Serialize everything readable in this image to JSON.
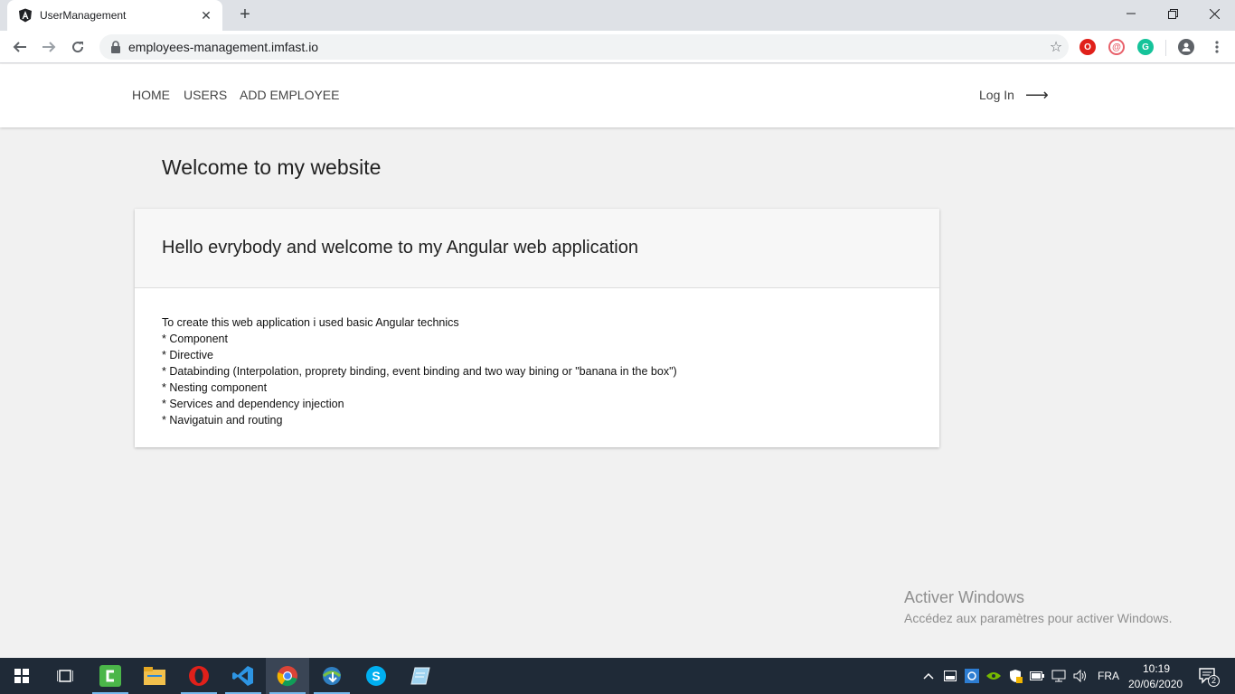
{
  "browser": {
    "tab_title": "UserManagement",
    "url": "employees-management.imfast.io"
  },
  "site": {
    "nav": [
      "HOME",
      "USERS",
      "ADD EMPLOYEE"
    ],
    "login": "Log In"
  },
  "main": {
    "title": "Welcome to my website",
    "card_title": "Hello evrybody and welcome to my Angular web application",
    "card_lines": [
      "To create this web application i used basic Angular technics",
      "* Component",
      "* Directive",
      "* Databinding (Interpolation, proprety binding, event binding and two way bining or \"banana in the box\")",
      "* Nesting component",
      "* Services and dependency injection",
      "* Navigatuin and routing"
    ]
  },
  "watermark": {
    "line1": "Activer Windows",
    "line2": "Accédez aux paramètres pour activer Windows."
  },
  "taskbar": {
    "lang": "FRA",
    "time": "10:19",
    "date": "20/06/2020",
    "notifications": "2"
  }
}
